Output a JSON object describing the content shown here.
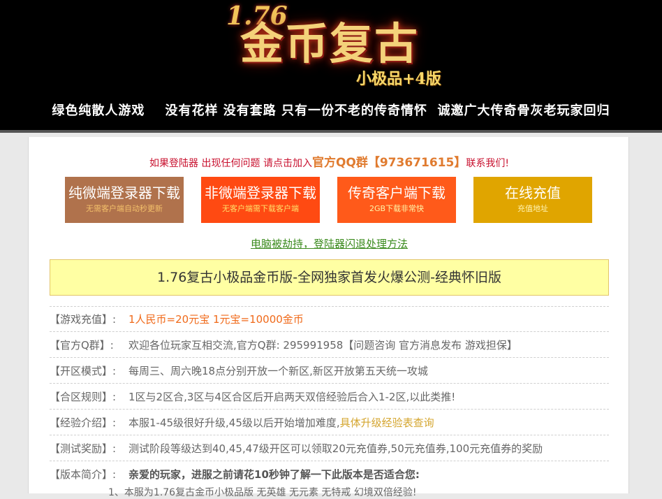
{
  "banner": {
    "logo_version": "1.76",
    "logo_title": "金币复古",
    "logo_subtitle": "小极品+4版",
    "slogan": "绿色纯散人游戏    没有花样 没有套路 只有一份不老的传奇情怀  诚邀广大传奇骨灰老玩家回归"
  },
  "notice": {
    "prefix": "如果登陆器 出现任何问题 请点击加入",
    "qq_group": "官方QQ群【973671615】",
    "suffix": "联系我们!"
  },
  "buttons": [
    {
      "title": "纯微端登录器下载",
      "sub": "无需客户端自动秒更新"
    },
    {
      "title": "非微端登录器下载",
      "sub": "无客户端需下载客户端"
    },
    {
      "title": "传奇客户端下载",
      "sub": "2GB下载非常快"
    },
    {
      "title": "在线充值",
      "sub": "充值地址"
    }
  ],
  "fix_link": "电脑被劫持，登陆器闪退处理方法",
  "headline": "1.76复古小极品金币版-全网独家首发火爆公测-经典怀旧版",
  "info": [
    {
      "label": "【游戏充值】:",
      "value": "1人民币=20元宝 1元宝=10000金币"
    },
    {
      "label": "【官方Q群】:",
      "value": "欢迎各位玩家互相交流,官方Q群: 295991958【问题咨询 官方消息发布 游戏担保】"
    },
    {
      "label": "【开区模式】:",
      "value": "每周三、周六晚18点分别开放一个新区,新区开放第五天统一攻城"
    },
    {
      "label": "【合区规则】:",
      "value": "1区与2区合,3区与4区合区后开启两天双倍经验后合入1-2区,以此类推!"
    },
    {
      "label": "【经验介绍】:",
      "value": "本服1-45级很好升级,45级以后开始增加难度,",
      "link": "具体升级经验表查询"
    },
    {
      "label": "【测试奖励】:",
      "value": "测试阶段等级达到40,45,47级开区可以领取20元充值券,50元充值券,100元充值券的奖励"
    },
    {
      "label": "【版本简介】:",
      "value": "亲爱的玩家，进服之前请花10秒钟了解一下此版本是否适合您:"
    }
  ],
  "intro_line": "1、本服为1.76复古金币小极品版 无英雄 无元素 无特戒 幻境双倍经验!"
}
